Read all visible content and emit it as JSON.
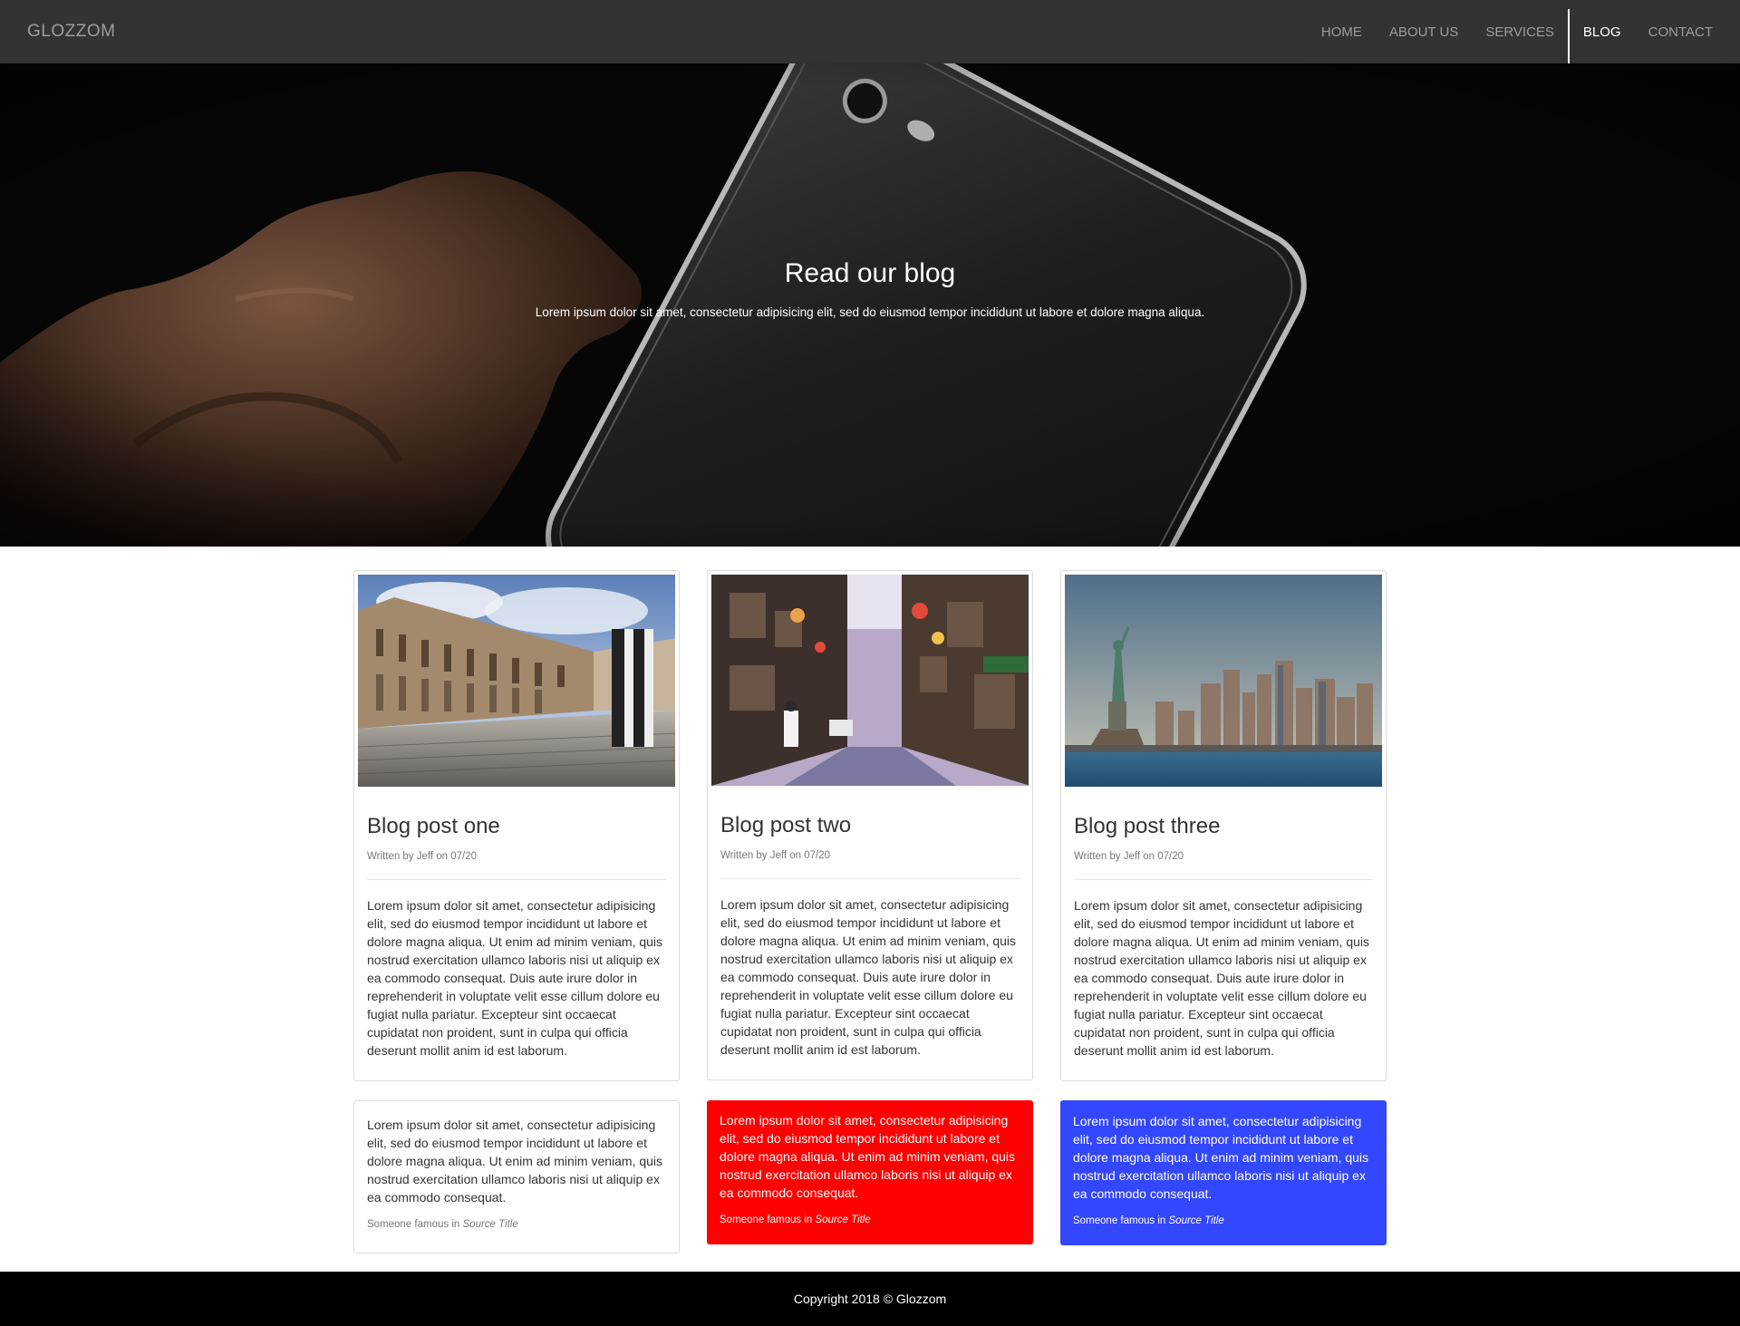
{
  "navbar": {
    "brand": "GLOZZOM",
    "items": [
      {
        "label": "HOME"
      },
      {
        "label": "ABOUT US"
      },
      {
        "label": "SERVICES"
      },
      {
        "label": "BLOG",
        "active": true
      },
      {
        "label": "CONTACT"
      }
    ]
  },
  "hero": {
    "title": "Read our blog",
    "subtitle": "Lorem ipsum dolor sit amet, consectetur adipisicing elit, sed do eiusmod tempor incididunt ut labore et dolore magna aliqua."
  },
  "posts": [
    {
      "title": "Blog post one",
      "meta": "Written by Jeff on 07/20",
      "body": "Lorem ipsum dolor sit amet, consectetur adipisicing elit, sed do eiusmod tempor incididunt ut labore et dolore magna aliqua. Ut enim ad minim veniam, quis nostrud exercitation ullamco laboris nisi ut aliquip ex ea commodo consequat. Duis aute irure dolor in reprehenderit in voluptate velit esse cillum dolore eu fugiat nulla pariatur. Excepteur sint occaecat cupidatat non proident, sunt in culpa qui officia deserunt mollit anim id est laborum."
    },
    {
      "title": "Blog post two",
      "meta": "Written by Jeff on 07/20",
      "body": "Lorem ipsum dolor sit amet, consectetur adipisicing elit, sed do eiusmod tempor incididunt ut labore et dolore magna aliqua. Ut enim ad minim veniam, quis nostrud exercitation ullamco laboris nisi ut aliquip ex ea commodo consequat. Duis aute irure dolor in reprehenderit in voluptate velit esse cillum dolore eu fugiat nulla pariatur. Excepteur sint occaecat cupidatat non proident, sunt in culpa qui officia deserunt mollit anim id est laborum."
    },
    {
      "title": "Blog post three",
      "meta": "Written by Jeff on 07/20",
      "body": "Lorem ipsum dolor sit amet, consectetur adipisicing elit, sed do eiusmod tempor incididunt ut labore et dolore magna aliqua. Ut enim ad minim veniam, quis nostrud exercitation ullamco laboris nisi ut aliquip ex ea commodo consequat. Duis aute irure dolor in reprehenderit in voluptate velit esse cillum dolore eu fugiat nulla pariatur. Excepteur sint occaecat cupidatat non proident, sunt in culpa qui officia deserunt mollit anim id est laborum."
    }
  ],
  "quotes": [
    {
      "text": "Lorem ipsum dolor sit amet, consectetur adipisicing elit, sed do eiusmod tempor incididunt ut labore et dolore magna aliqua. Ut enim ad minim veniam, quis nostrud exercitation ullamco laboris nisi ut aliquip ex ea commodo consequat.",
      "source_prefix": "Someone famous in",
      "source_title": "Source Title",
      "color": "#ffffff"
    },
    {
      "text": "Lorem ipsum dolor sit amet, consectetur adipisicing elit, sed do eiusmod tempor incididunt ut labore et dolore magna aliqua. Ut enim ad minim veniam, quis nostrud exercitation ullamco laboris nisi ut aliquip ex ea commodo consequat.",
      "source_prefix": "Someone famous in",
      "source_title": "Source Title",
      "color": "#ff0000"
    },
    {
      "text": "Lorem ipsum dolor sit amet, consectetur adipisicing elit, sed do eiusmod tempor incididunt ut labore et dolore magna aliqua. Ut enim ad minim veniam, quis nostrud exercitation ullamco laboris nisi ut aliquip ex ea commodo consequat.",
      "source_prefix": "Someone famous in",
      "source_title": "Source Title",
      "color": "#3347ff"
    }
  ],
  "footer": {
    "copyright": "Copyright 2018 © Glozzom"
  }
}
